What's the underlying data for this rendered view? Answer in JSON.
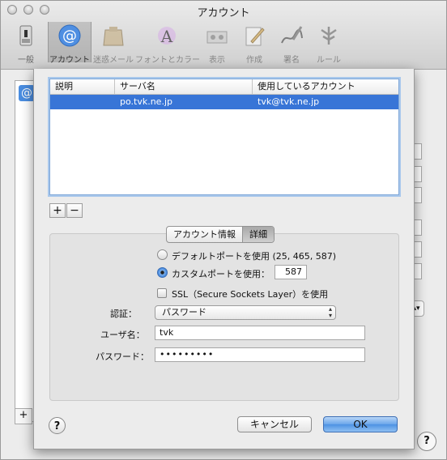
{
  "window": {
    "title": "アカウント"
  },
  "toolbar": {
    "items": [
      {
        "label": "一般",
        "icon": "switch-icon"
      },
      {
        "label": "アカウント",
        "icon": "at-icon"
      },
      {
        "label": "迷惑メール",
        "icon": "junk-bag-icon"
      },
      {
        "label": "フォントとカラー",
        "icon": "font-icon"
      },
      {
        "label": "表示",
        "icon": "view-icon"
      },
      {
        "label": "作成",
        "icon": "compose-icon"
      },
      {
        "label": "署名",
        "icon": "signature-icon"
      },
      {
        "label": "ルール",
        "icon": "rules-icon"
      }
    ]
  },
  "server_table": {
    "headers": [
      "説明",
      "サーバ名",
      "使用しているアカウント"
    ],
    "rows": [
      {
        "description": "",
        "server": "po.tvk.ne.jp",
        "account": "tvk@tvk.ne.jp"
      }
    ]
  },
  "list_buttons": {
    "add": "+",
    "remove": "−"
  },
  "tabs": {
    "account_info": "アカウント情報",
    "details": "詳細"
  },
  "port": {
    "default_label": "デフォルトポートを使用 (25, 465, 587)",
    "custom_label": "カスタムポートを使用：",
    "custom_value": "587",
    "selected": "custom"
  },
  "ssl": {
    "label": "SSL（Secure Sockets Layer）を使用",
    "checked": false
  },
  "auth": {
    "label": "認証：",
    "value": "パスワード"
  },
  "username": {
    "label": "ユーザ名：",
    "value": "tvk"
  },
  "password": {
    "label": "パスワード：",
    "value": "•••••••••"
  },
  "footer": {
    "help": "?",
    "cancel": "キャンセル",
    "ok": "OK"
  },
  "background": {
    "add": "+",
    "help": "?"
  },
  "colors": {
    "selection": "#3875d7",
    "default_button": "#5a9be8"
  }
}
